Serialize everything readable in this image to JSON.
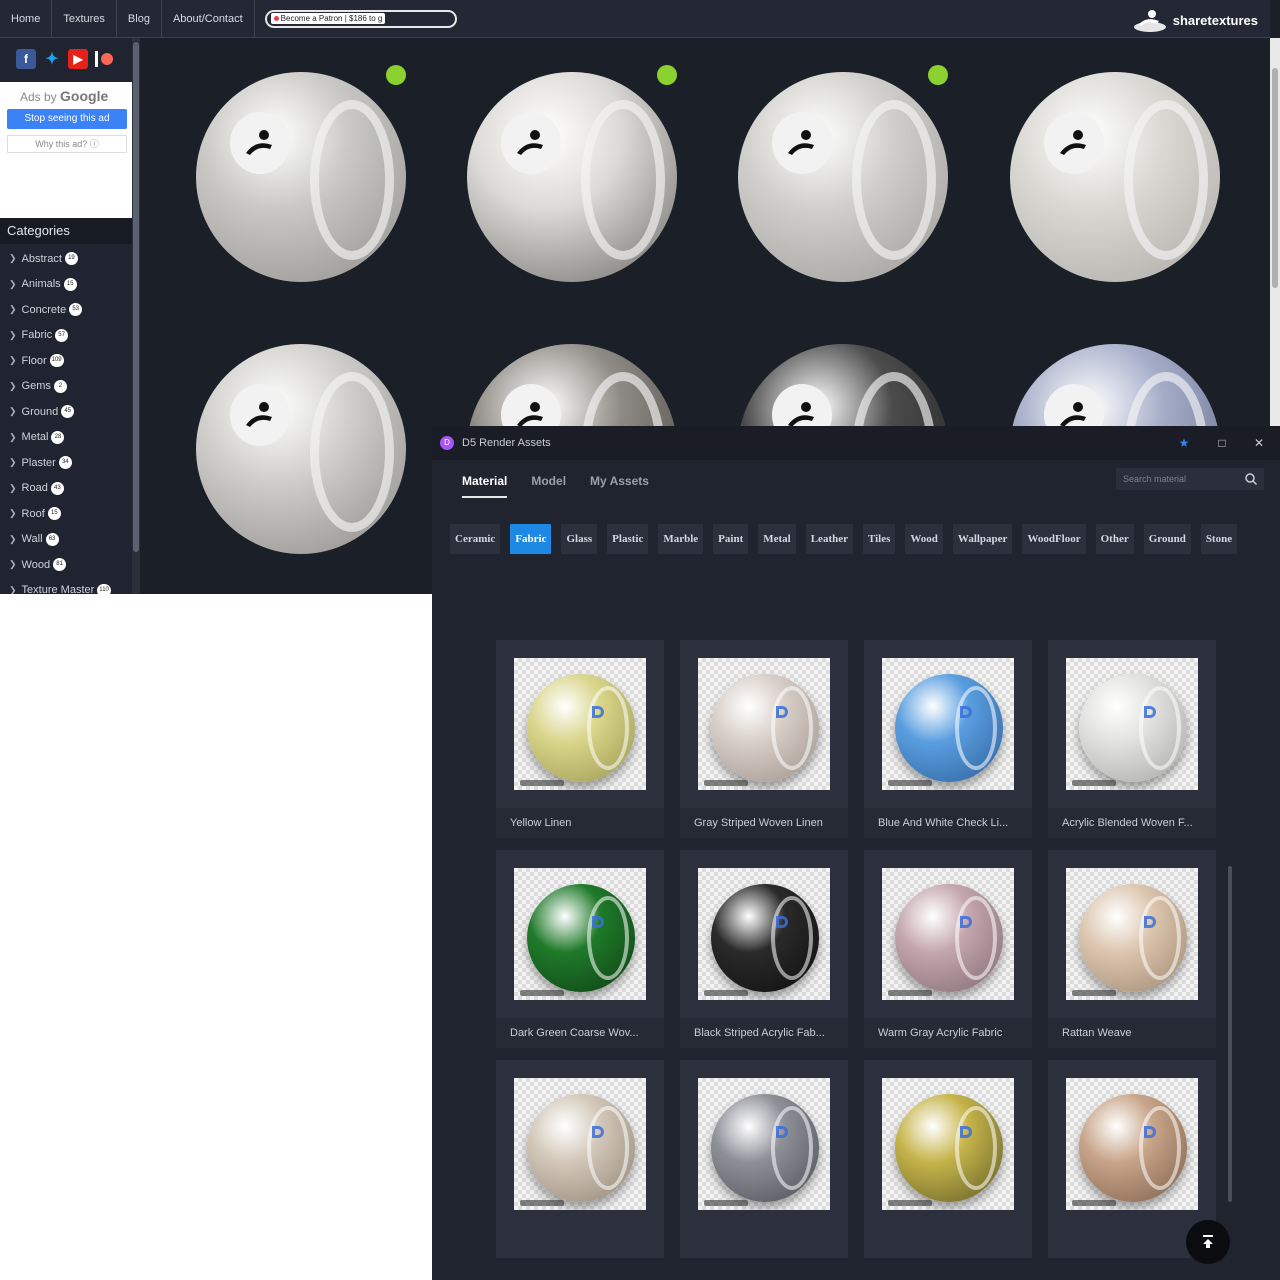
{
  "site": {
    "nav": [
      "Home",
      "Textures",
      "Blog",
      "About/Contact"
    ],
    "patron": "Become a Patron | $186 to g",
    "brand": "sharetextures"
  },
  "ads": {
    "ads_by": "Ads by",
    "google": "Google",
    "stop": "Stop seeing this ad",
    "why": "Why this ad? ⓘ"
  },
  "categories": {
    "title": "Categories",
    "items": [
      {
        "name": "Abstract",
        "count": "19"
      },
      {
        "name": "Animals",
        "count": "15"
      },
      {
        "name": "Concrete",
        "count": "53"
      },
      {
        "name": "Fabric",
        "count": "57"
      },
      {
        "name": "Floor",
        "count": "109"
      },
      {
        "name": "Gems",
        "count": "2"
      },
      {
        "name": "Ground",
        "count": "45"
      },
      {
        "name": "Metal",
        "count": "28"
      },
      {
        "name": "Plaster",
        "count": "34"
      },
      {
        "name": "Road",
        "count": "43"
      },
      {
        "name": "Roof",
        "count": "15"
      },
      {
        "name": "Wall",
        "count": "63"
      },
      {
        "name": "Wood",
        "count": "81"
      },
      {
        "name": "Texture Master",
        "count": "110"
      }
    ]
  },
  "spheres": [
    {
      "base": "#c9c8c4",
      "dark": "#8f8e8a",
      "dot": true
    },
    {
      "base": "#dcdad6",
      "dark": "#6b6a66",
      "dot": true
    },
    {
      "base": "#d0cfcb",
      "dark": "#9a9995",
      "dot": true
    },
    {
      "base": "#d9d8d3",
      "dark": "#a9a8a3",
      "dot": false
    },
    {
      "base": "#cfceca",
      "dark": "#8a8985",
      "dot": false
    },
    {
      "base": "#8e8a84",
      "dark": "#3f3d39",
      "dot": false
    },
    {
      "base": "#4b4b4b",
      "dark": "#1c1c1c",
      "dot": false
    },
    {
      "base": "#a4acc8",
      "dark": "#59627f",
      "dot": false
    }
  ],
  "d5": {
    "title": "D5 Render Assets",
    "tabs": [
      {
        "label": "Material",
        "active": true
      },
      {
        "label": "Model",
        "active": false
      },
      {
        "label": "My Assets",
        "active": false
      }
    ],
    "search_placeholder": "Search material",
    "categories": [
      {
        "label": "Ceramic",
        "active": false
      },
      {
        "label": "Fabric",
        "active": true
      },
      {
        "label": "Glass",
        "active": false
      },
      {
        "label": "Plastic",
        "active": false
      },
      {
        "label": "Marble",
        "active": false
      },
      {
        "label": "Paint",
        "active": false
      },
      {
        "label": "Metal",
        "active": false
      },
      {
        "label": "Leather",
        "active": false
      },
      {
        "label": "Tiles",
        "active": false
      },
      {
        "label": "Wood",
        "active": false
      },
      {
        "label": "Wallpaper",
        "active": false
      },
      {
        "label": "WoodFloor",
        "active": false
      },
      {
        "label": "Other",
        "active": false
      },
      {
        "label": "Ground",
        "active": false
      },
      {
        "label": "Stone",
        "active": false
      }
    ],
    "materials": [
      {
        "name": "Yellow Linen",
        "color": "#d9d58a",
        "shade": "#9a9650"
      },
      {
        "name": "Gray Striped Woven Linen",
        "color": "#d8cfc8",
        "shade": "#9d9189"
      },
      {
        "name": "Blue And White Check Li...",
        "color": "#5a9ee0",
        "shade": "#2c5f99"
      },
      {
        "name": "Acrylic Blended Woven F...",
        "color": "#e2e2e0",
        "shade": "#a5a5a2"
      },
      {
        "name": "Dark Green Coarse Wov...",
        "color": "#1f7a2a",
        "shade": "#0d3d13"
      },
      {
        "name": "Black Striped Acrylic Fab...",
        "color": "#2a2a2a",
        "shade": "#0d0d0d"
      },
      {
        "name": "Warm Gray Acrylic Fabric",
        "color": "#c4a6ae",
        "shade": "#7f6870"
      },
      {
        "name": "Rattan Weave",
        "color": "#dcc6b0",
        "shade": "#9c8670"
      },
      {
        "name": "",
        "color": "#d2c7b8",
        "shade": "#8f8474"
      },
      {
        "name": "",
        "color": "#8e8f97",
        "shade": "#4b4c54"
      },
      {
        "name": "",
        "color": "#c6b44a",
        "shade": "#5d5a25"
      },
      {
        "name": "",
        "color": "#c8a58a",
        "shade": "#7d5e47"
      }
    ]
  }
}
